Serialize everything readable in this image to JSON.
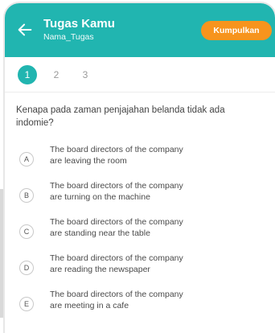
{
  "header": {
    "title": "Tugas Kamu",
    "subtitle": "Nama_Tugas",
    "submit_label": "Kumpulkan"
  },
  "steps": [
    {
      "label": "1",
      "active": true
    },
    {
      "label": "2",
      "active": false
    },
    {
      "label": "3",
      "active": false
    }
  ],
  "question": "Kenapa pada zaman penjajahan belanda tidak ada indomie?",
  "options": [
    {
      "letter": "A",
      "line1": "The board directors of the company",
      "line2": "are leaving the room"
    },
    {
      "letter": "B",
      "line1": "The board directors of the company",
      "line2": "are turning on the machine"
    },
    {
      "letter": "C",
      "line1": "The board directors of the company",
      "line2": "are standing near the table"
    },
    {
      "letter": "D",
      "line1": "The board directors of the company",
      "line2": "are reading the newspaper"
    },
    {
      "letter": "E",
      "line1": "The board directors of the company",
      "line2": "are meeting in a cafe"
    }
  ],
  "colors": {
    "primary": "#21b5b0",
    "accent": "#f7941d"
  },
  "icons": {
    "back": "arrow-left-icon"
  }
}
